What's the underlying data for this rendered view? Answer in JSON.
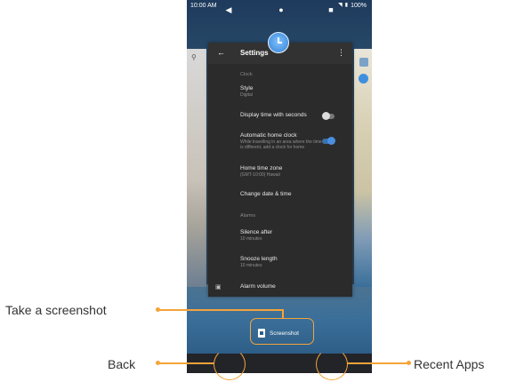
{
  "status_bar": {
    "time": "10:00 AM",
    "battery": "100%"
  },
  "settings_card": {
    "title": "Settings",
    "section_clock": "Clock",
    "style_title": "Style",
    "style_value": "Digital",
    "display_seconds": "Display time with seconds",
    "auto_home_clock_title": "Automatic home clock",
    "auto_home_clock_sub": "While travelling in an area where the time is different, add a clock for home",
    "home_time_zone_title": "Home time zone",
    "home_time_zone_value": "(GMT-10:00) Hawaii",
    "change_date_time": "Change date & time",
    "section_alarms": "Alarms",
    "silence_after_title": "Silence after",
    "silence_after_value": "10 minutes",
    "snooze_length_title": "Snooze length",
    "snooze_length_value": "10 minutes",
    "alarm_volume": "Alarm volume"
  },
  "screenshot_button": {
    "label": "Screenshot"
  },
  "callouts": {
    "take_screenshot": "Take a screenshot",
    "back": "Back",
    "recent_apps": "Recent Apps"
  },
  "colors": {
    "accent": "#f5a33a",
    "nav_bg": "#222428",
    "card_bg": "#2b2b2b"
  },
  "icons": [
    "search-icon",
    "back-arrow-icon",
    "overflow-menu-icon",
    "clock-app-icon",
    "alarm-icon",
    "screenshot-icon",
    "back-nav-icon",
    "home-nav-icon",
    "recent-apps-icon",
    "wifi-icon",
    "battery-icon"
  ]
}
